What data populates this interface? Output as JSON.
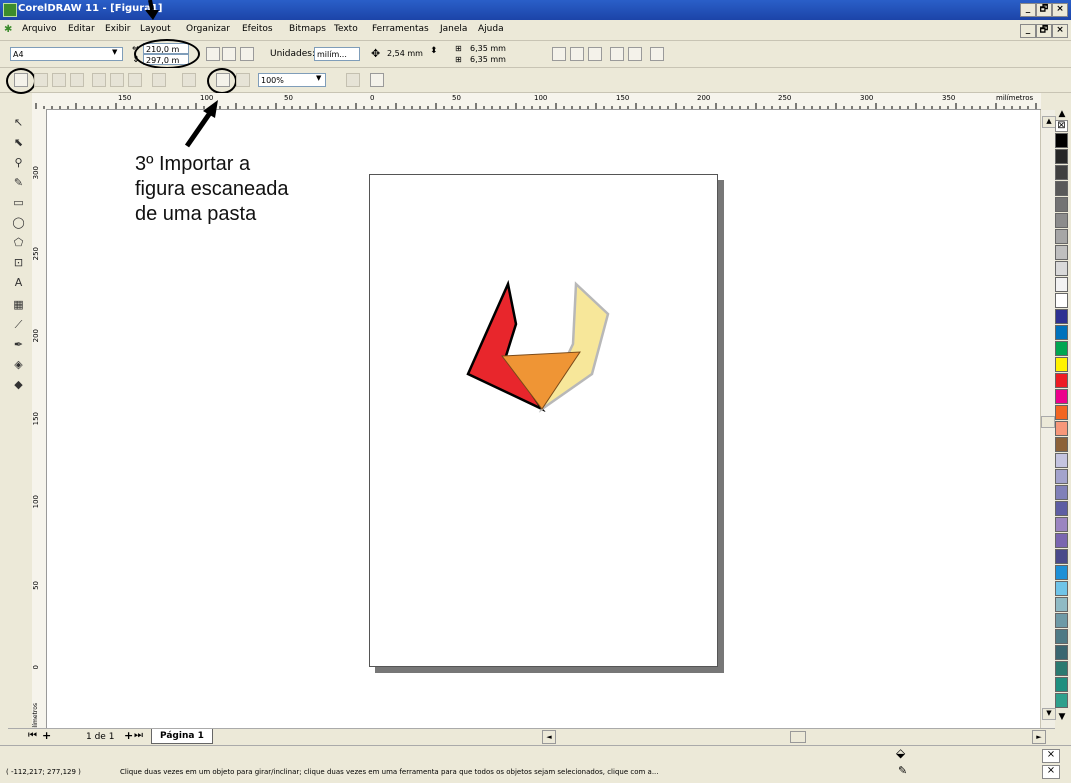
{
  "window": {
    "title": "CorelDRAW 11 - [Figura1]",
    "minimize": "_",
    "restore": "🗗",
    "close": "×"
  },
  "menubar": {
    "items": [
      "Arquivo",
      "Editar",
      "Exibir",
      "Layout",
      "Organizar",
      "Efeitos",
      "Bitmaps",
      "Texto",
      "Ferramentas",
      "Janela",
      "Ajuda"
    ]
  },
  "propertybar": {
    "paper_size": "A4",
    "width_value": "210,0 m",
    "height_value": "297,0 m",
    "units_label": "Unidades:",
    "units_value": "milím...",
    "nudge_value": "2,54 mm",
    "dup_x_value": "6,35 mm",
    "dup_y_value": "6,35 mm"
  },
  "standardbar": {
    "zoom_value": "100%"
  },
  "rulers": {
    "units": "milímetros",
    "h_ticks": [
      "150",
      "100",
      "50",
      "0",
      "50",
      "100",
      "150",
      "200",
      "250",
      "300",
      "350"
    ],
    "v_ticks": [
      "300",
      "250",
      "200",
      "150",
      "100",
      "50",
      "0"
    ],
    "v_units": "milímetros"
  },
  "annotation": {
    "line1": "3º Importar a",
    "line2": "figura escaneada",
    "line3": "de uma pasta"
  },
  "pagebar": {
    "counter": "1 de 1",
    "page_tab": "Página 1"
  },
  "statusbar": {
    "coords": "( -112,217; 277,129 )",
    "hint": "Clique duas vezes em um objeto para girar/inclinar; clique duas vezes em uma ferramenta para que todos os objetos sejam selecionados, clique com a..."
  },
  "colors": {
    "shape_red": "#e8262c",
    "shape_yellow": "#f7e79a",
    "shape_orange": "#ef9535",
    "palette": [
      "#000000",
      "#262626",
      "#404040",
      "#595959",
      "#737373",
      "#8c8c8c",
      "#a6a6a6",
      "#bfbfbf",
      "#d9d9d9",
      "#f2f2f2",
      "#ffffff",
      "#2e3192",
      "#0072bc",
      "#00a651",
      "#fff200",
      "#ed1c24",
      "#ec008c",
      "#f26522",
      "#f7977a",
      "#8c6239",
      "#c4c4e0",
      "#a3a3cc",
      "#8080b8",
      "#5e5ea3",
      "#9b85c0",
      "#7a66b0",
      "#4a4a8a",
      "#1e90d6",
      "#6fc4e8",
      "#8fbac4",
      "#6e9aa6",
      "#4f7a85",
      "#3a6670",
      "#2a7a70",
      "#1f8f7f",
      "#2fa08c"
    ]
  }
}
